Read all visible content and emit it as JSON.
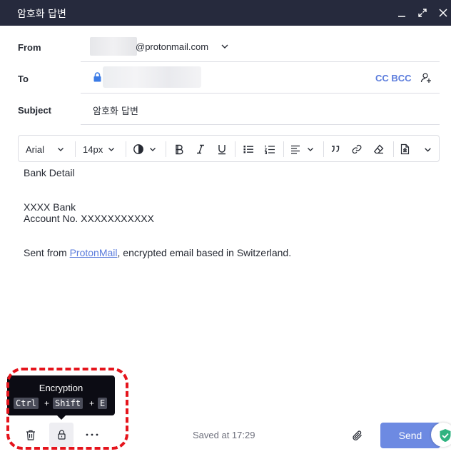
{
  "window": {
    "title": "암호화 답변"
  },
  "header": {
    "from_label": "From",
    "from_domain": "@protonmail.com",
    "to_label": "To",
    "cc_bcc": "CC BCC",
    "subject_label": "Subject",
    "subject_value": "암호화 답변"
  },
  "toolbar": {
    "font_family": "Arial",
    "font_size": "14px"
  },
  "body": {
    "line1": "Bank Detail",
    "line2": "XXXX Bank",
    "line3": "Account No. XXXXXXXXXXX",
    "sig_prefix": "Sent from ",
    "sig_link": "ProtonMail",
    "sig_suffix": ", encrypted email based in Switzerland."
  },
  "tooltip": {
    "title": "Encryption",
    "key1": "Ctrl",
    "plus1": "+",
    "key2": "Shift",
    "plus2": "+",
    "key3": "E"
  },
  "footer": {
    "saved_text": "Saved at 17:29",
    "send_label": "Send"
  },
  "colors": {
    "accent": "#6d8ae2",
    "titlebar": "#262a3d",
    "highlight": "#e5141c",
    "shield": "#2fb380"
  }
}
